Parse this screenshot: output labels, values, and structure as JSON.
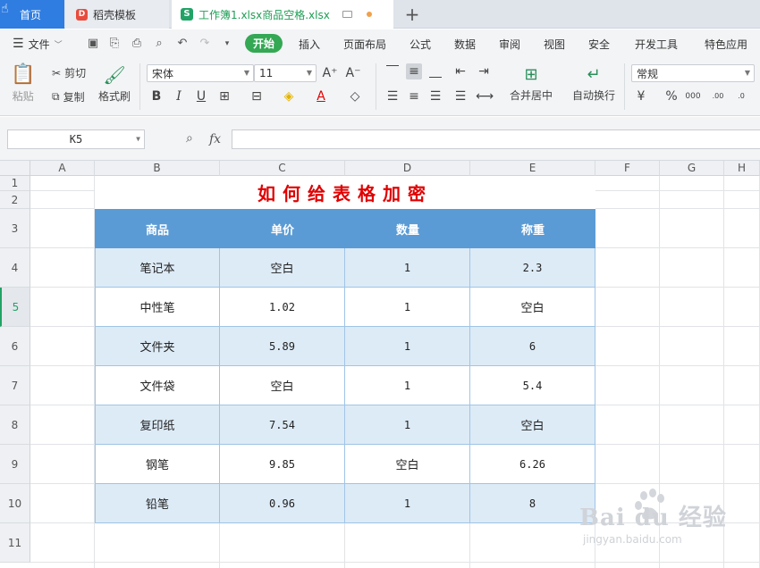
{
  "tabs": {
    "home": "首页",
    "template": "稻壳模板",
    "file": "工作簿1.xlsx商品空格.xlsx",
    "add": "+"
  },
  "menu": {
    "file": "文件",
    "start": "开始",
    "items": [
      "插入",
      "页面布局",
      "公式",
      "数据",
      "审阅",
      "视图",
      "安全",
      "开发工具",
      "特色应用"
    ]
  },
  "ribbon": {
    "paste": "粘贴",
    "cut": "剪切",
    "copy": "复制",
    "format_painter": "格式刷",
    "font_name": "宋体",
    "font_size": "11",
    "merge_center": "合并居中",
    "auto_wrap": "自动换行",
    "number_format": "常规"
  },
  "formula_bar": {
    "cell_ref": "K5",
    "fx": "fx",
    "value": ""
  },
  "sheet": {
    "columns": [
      "A",
      "B",
      "C",
      "D",
      "E",
      "F",
      "G",
      "H"
    ],
    "rows": [
      "1",
      "2",
      "3",
      "4",
      "5",
      "6",
      "7",
      "8",
      "9",
      "10",
      "11"
    ],
    "current_row": "5",
    "title": "如何给表格加密",
    "headers": [
      "商品",
      "单价",
      "数量",
      "称重"
    ],
    "data": [
      [
        "笔记本",
        "空白",
        "1",
        "2.3"
      ],
      [
        "中性笔",
        "1.02",
        "1",
        "空白"
      ],
      [
        "文件夹",
        "5.89",
        "1",
        "6"
      ],
      [
        "文件袋",
        "空白",
        "1",
        "5.4"
      ],
      [
        "复印纸",
        "7.54",
        "1",
        "空白"
      ],
      [
        "钢笔",
        "9.85",
        "空白",
        "6.26"
      ],
      [
        "铅笔",
        "0.96",
        "1",
        "8"
      ]
    ]
  },
  "watermark": {
    "main": "Bai du 经验",
    "sub": "jingyan.baidu.com"
  },
  "colors": {
    "header_fill": "#5b9bd5",
    "alt_fill": "#ddebf7",
    "title_color": "#e00000",
    "accent_green": "#21a366",
    "tab_blue": "#2f7de1"
  }
}
